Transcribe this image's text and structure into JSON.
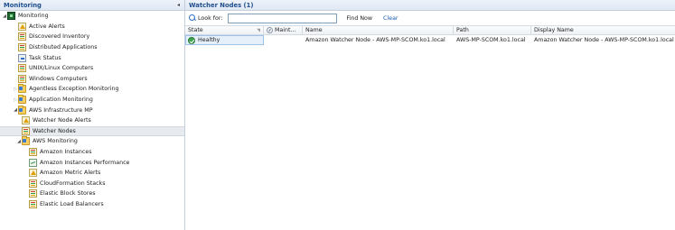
{
  "nav": {
    "title": "Monitoring",
    "collapse_glyph": "◂",
    "items": [
      {
        "label": "Monitoring",
        "icon": "monitoring-icon",
        "indent": 0,
        "expander": "open"
      },
      {
        "label": "Active Alerts",
        "icon": "alert-icon",
        "indent": 1,
        "expander": "none"
      },
      {
        "label": "Discovered Inventory",
        "icon": "state-view-icon",
        "indent": 1,
        "expander": "none"
      },
      {
        "label": "Distributed Applications",
        "icon": "state-view-icon",
        "indent": 1,
        "expander": "none"
      },
      {
        "label": "Task Status",
        "icon": "task-icon",
        "indent": 1,
        "expander": "none"
      },
      {
        "label": "UNIX/Linux Computers",
        "icon": "state-view-icon",
        "indent": 1,
        "expander": "none"
      },
      {
        "label": "Windows Computers",
        "icon": "state-view-icon",
        "indent": 1,
        "expander": "none"
      },
      {
        "label": "Agentless Exception Monitoring",
        "icon": "folder-icon",
        "indent": 1,
        "expander": "closed"
      },
      {
        "label": "Application Monitoring",
        "icon": "folder-icon",
        "indent": 1,
        "expander": "closed"
      },
      {
        "label": "AWS Infrastructure MP",
        "icon": "folder-icon",
        "indent": 1,
        "expander": "open"
      },
      {
        "label": "Watcher Node Alerts",
        "icon": "alert-icon",
        "indent": 2,
        "expander": "none"
      },
      {
        "label": "Watcher Nodes",
        "icon": "state-view-icon",
        "indent": 2,
        "expander": "none",
        "selected": true
      },
      {
        "label": "AWS Monitoring",
        "icon": "folder-icon",
        "indent": 2,
        "expander": "open"
      },
      {
        "label": "Amazon Instances",
        "icon": "state-view-icon",
        "indent": 3,
        "expander": "none"
      },
      {
        "label": "Amazon Instances Performance",
        "icon": "performance-icon",
        "indent": 3,
        "expander": "none"
      },
      {
        "label": "Amazon Metric Alerts",
        "icon": "alert-icon",
        "indent": 3,
        "expander": "none"
      },
      {
        "label": "CloudFormation Stacks",
        "icon": "state-view-icon",
        "indent": 3,
        "expander": "none"
      },
      {
        "label": "Elastic Block Stores",
        "icon": "state-view-icon",
        "indent": 3,
        "expander": "none"
      },
      {
        "label": "Elastic Load Balancers",
        "icon": "state-view-icon",
        "indent": 3,
        "expander": "none"
      }
    ]
  },
  "main": {
    "title": "Watcher Nodes (1)",
    "toolbar": {
      "look_for_label": "Look for:",
      "search_value": "",
      "find_now_label": "Find Now",
      "clear_label": "Clear"
    },
    "columns": {
      "state": "State",
      "maintenance": "Maint...",
      "name": "Name",
      "path": "Path",
      "display_name": "Display Name"
    },
    "rows": [
      {
        "state": "Healthy",
        "maintenance": "",
        "name": "Amazon Watcher Node - AWS-MP-SCOM.ko1.local",
        "path": "AWS-MP-SCOM.ko1.local",
        "display_name": "Amazon Watcher Node - AWS-MP-SCOM.ko1.local"
      }
    ]
  },
  "colors": {
    "header_text": "#1f4e8c",
    "selection_bg": "#e6f0fb",
    "healthy": "#3fa34d",
    "link": "#1a5db5"
  }
}
